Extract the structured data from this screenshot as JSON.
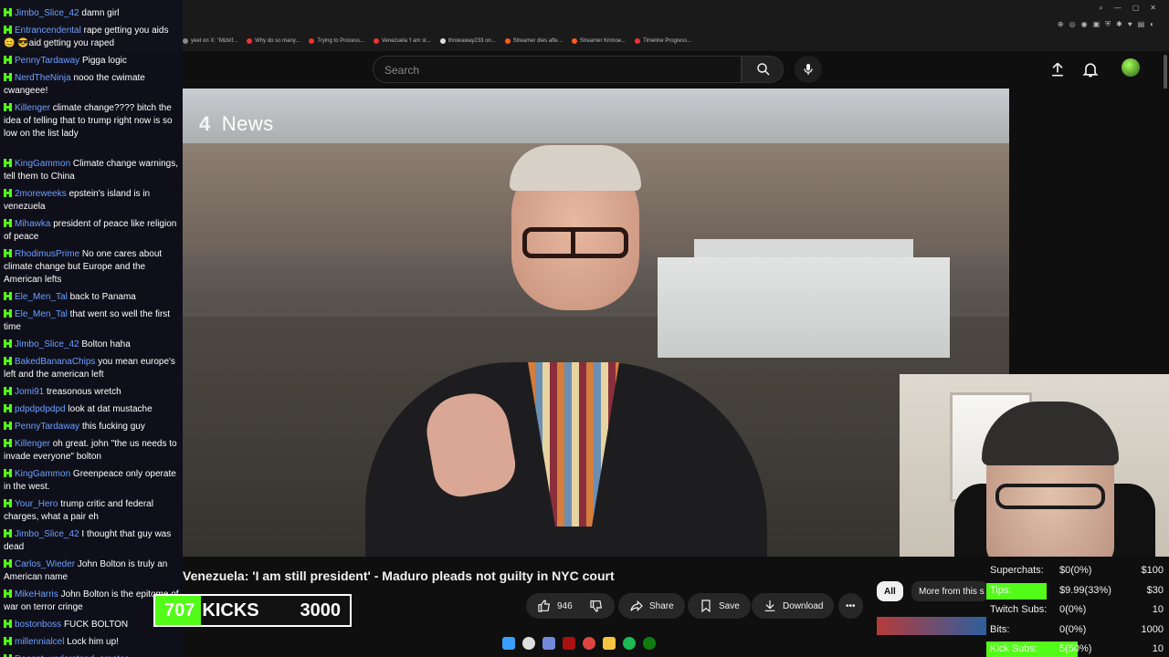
{
  "browser": {
    "tabs": [
      "yeet on X: \"Mizkif...",
      "Why do so many...",
      "Trying to Process...",
      "Venezuela 'I am st...",
      "throwaway233 on...",
      "Streamer dies afte...",
      "Streamer Krimoe...",
      "Timeline Progress..."
    ]
  },
  "youtube": {
    "search_placeholder": "Search",
    "video_title": "Venezuela: 'I am still president' - Maduro pleads not guilty in NYC court",
    "channel": "Channel 4 News",
    "logo_text": "News",
    "actions": {
      "likes": "946",
      "share": "Share",
      "save": "Save",
      "download": "Download"
    },
    "chips": {
      "all": "All",
      "more": "More from this s"
    }
  },
  "chat": [
    {
      "user": "Jimbo_Slice_42",
      "text": "damn girl"
    },
    {
      "user": "Entrancendental",
      "text": "rape getting you aids 😊 😎aid getting you raped"
    },
    {
      "user": "PennyTardaway",
      "text": "Pigga logic"
    },
    {
      "user": "NerdTheNinja",
      "text": "nooo the cwimate cwangeee!"
    },
    {
      "user": "Killenger",
      "text": "climate change???? bitch the idea of telling that to trump right now is so low on the list lady"
    },
    {
      "user": "KingGammon",
      "text": "Climate change warnings, tell them to China"
    },
    {
      "user": "2moreweeks",
      "text": "epstein's island is in venezuela"
    },
    {
      "user": "Mihawka",
      "text": "president of peace like religion of peace"
    },
    {
      "user": "RhodimusPrime",
      "text": "No one cares about climate change but Europe and the American lefts"
    },
    {
      "user": "Ele_Men_Tal",
      "text": "back to Panama"
    },
    {
      "user": "Ele_Men_Tal",
      "text": "that went so well the first time"
    },
    {
      "user": "Jimbo_Slice_42",
      "text": "Bolton haha"
    },
    {
      "user": "BakedBananaChips",
      "text": "you mean europe's left and the american left"
    },
    {
      "user": "Jomi91",
      "text": "treasonous wretch"
    },
    {
      "user": "pdpdpdpdpd",
      "text": "look at dat mustache"
    },
    {
      "user": "PennyTardaway",
      "text": "this fucking guy"
    },
    {
      "user": "Killenger",
      "text": "oh great. john \"the us needs to invade everyone\" bolton"
    },
    {
      "user": "KingGammon",
      "text": "Greenpeace only operate in the west."
    },
    {
      "user": "Your_Hero",
      "text": "trump critic and federal charges, what a pair eh"
    },
    {
      "user": "Jimbo_Slice_42",
      "text": "I thought that guy was dead"
    },
    {
      "user": "Carlos_Wieder",
      "text": "John Bolton is truly an American name"
    },
    {
      "user": "MikeHarris",
      "text": "John Bolton is the epitome of war on terror cringe"
    },
    {
      "user": "bostonboss",
      "text": "FUCK BOLTON"
    },
    {
      "user": "millennialcel",
      "text": "Lock him up!"
    },
    {
      "user": "Doesnt_understand_emotes",
      "text": ""
    }
  ],
  "kicks": {
    "count": "707",
    "label": "KICKS",
    "goal": "3000",
    "progress": 0.2357
  },
  "stats": [
    {
      "key": "Superchats:",
      "value": "$0(0%)",
      "goal": "$100",
      "highlight": 0
    },
    {
      "key": "Tips:",
      "value": "$9.99(33%)",
      "goal": "$30",
      "highlight": 0.33
    },
    {
      "key": "Twitch Subs:",
      "value": "0(0%)",
      "goal": "10",
      "highlight": 0
    },
    {
      "key": "Bits:",
      "value": "0(0%)",
      "goal": "1000",
      "highlight": 0
    },
    {
      "key": "Kick Subs:",
      "value": "5(50%)",
      "goal": "10",
      "highlight": 0.5
    }
  ],
  "colors": {
    "kick_green": "#53fc18",
    "chat_user": "#6aa0ff"
  }
}
